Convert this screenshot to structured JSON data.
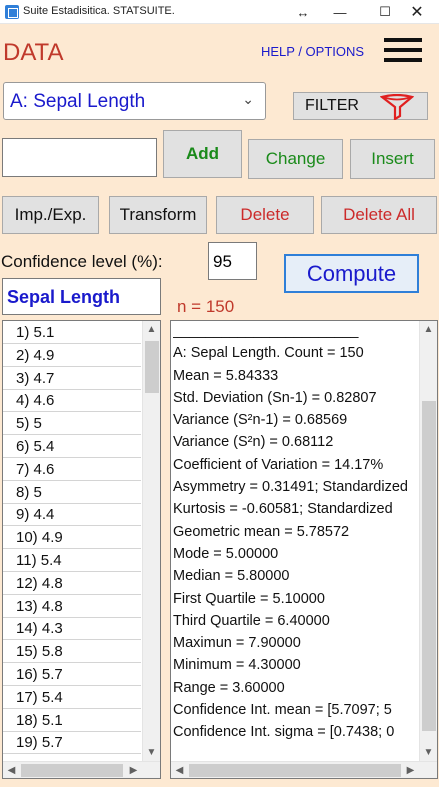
{
  "window": {
    "title": "Suite Estadisitica. STATSUITE.",
    "minimize": "—",
    "maximize": "☐",
    "close": "✕",
    "resize": "↔"
  },
  "header": {
    "title": "DATA",
    "help": "HELP / OPTIONS"
  },
  "variable_select": {
    "value": "A: Sepal Length"
  },
  "buttons": {
    "filter": "FILTER",
    "add": "Add",
    "change": "Change",
    "insert": "Insert",
    "import_export": "Imp./Exp.",
    "transform": "Transform",
    "delete": "Delete",
    "delete_all": "Delete All",
    "compute": "Compute"
  },
  "input": {
    "value": ""
  },
  "confidence": {
    "label": "Confidence level (%):",
    "value": "95"
  },
  "variable_name": "Sepal Length",
  "sample_size": "n = 150",
  "data_list": [
    "1) 5.1",
    "2) 4.9",
    "3) 4.7",
    "4) 4.6",
    "5) 5",
    "6) 5.4",
    "7) 4.6",
    "8) 5",
    "9) 4.4",
    "10) 4.9",
    "11) 5.4",
    "12) 4.8",
    "13) 4.8",
    "14) 4.3",
    "15) 5.8",
    "16) 5.7",
    "17) 5.4",
    "18) 5.1",
    "19) 5.7"
  ],
  "results": [
    "_______________________",
    "A: Sepal Length. Count = 150",
    "Mean = 5.84333",
    "Std. Deviation (Sn-1) = 0.82807",
    "Variance (S²n-1) = 0.68569",
    "Variance (S²n) = 0.68112",
    "Coefficient of Variation = 14.17%",
    "Asymmetry = 0.31491; Standardized",
    "Kurtosis = -0.60581; Standardized",
    "Geometric mean = 5.78572",
    "Mode = 5.00000",
    "Median = 5.80000",
    "First Quartile = 5.10000",
    "Third Quartile = 6.40000",
    "Maximun = 7.90000",
    "Minimum = 4.30000",
    "Range = 3.60000",
    "Confidence Int. mean = [5.7097; 5",
    "Confidence Int. sigma = [0.7438; 0",
    "_______________________"
  ],
  "colors": {
    "background": "#fde9d2",
    "title_red": "#c0392b",
    "link_blue": "#1a1acc",
    "green": "#1a8a1a",
    "delete_red": "#cc2a2a",
    "accent_blue": "#2f7fd8"
  },
  "icons": {
    "app": "app-icon",
    "filter": "funnel-icon",
    "menu": "hamburger-icon",
    "select": "chevron-down-icon"
  }
}
